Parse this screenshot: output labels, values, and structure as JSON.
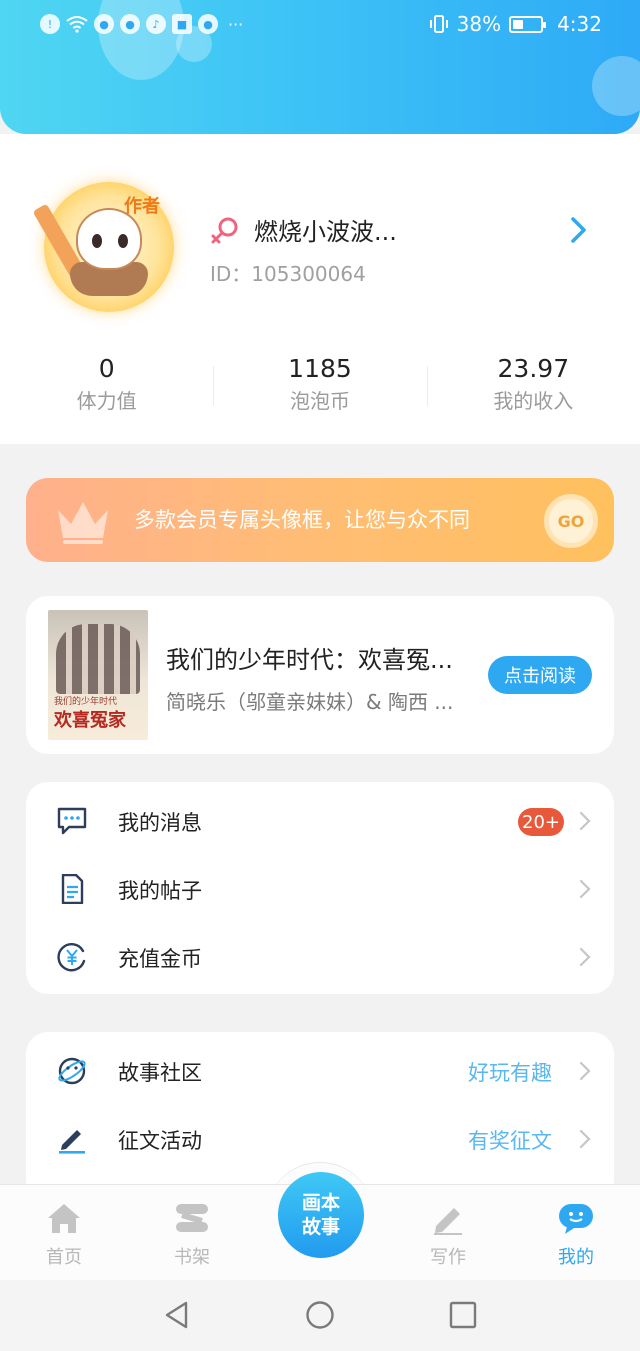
{
  "status_bar": {
    "notification_icons": [
      "info-icon",
      "wifi-icon",
      "app-icon",
      "app-icon",
      "music-icon",
      "game-icon",
      "app-icon"
    ],
    "more": "···",
    "battery_percent": "38%",
    "battery_level": 0.38,
    "time": "4:32"
  },
  "profile": {
    "avatar_tag": "作者",
    "nickname": "燃烧小波波...",
    "user_id": "ID：105300064",
    "stats": [
      {
        "value": "0",
        "label": "体力值"
      },
      {
        "value": "1185",
        "label": "泡泡币"
      },
      {
        "value": "23.97",
        "label": "我的收入"
      }
    ]
  },
  "vip_banner": {
    "text": "多款会员专属头像框，让您与众不同",
    "go_label": "GO"
  },
  "book": {
    "cover_subtitle": "我们的少年时代",
    "cover_title": "欢喜冤家",
    "title": "我们的少年时代：欢喜冤...",
    "authors": "简晓乐（邬童亲妹妹）& 陶西 ...",
    "read_button": "点击阅读"
  },
  "menu": {
    "items": [
      {
        "label": "我的消息",
        "icon": "message-icon",
        "badge": "20+"
      },
      {
        "label": "我的帖子",
        "icon": "document-icon"
      },
      {
        "label": "充值金币",
        "icon": "yen-coin-icon"
      }
    ]
  },
  "menu2": {
    "items": [
      {
        "label": "故事社区",
        "icon": "planet-icon",
        "hint": "好玩有趣"
      },
      {
        "label": "征文活动",
        "icon": "pen-icon",
        "hint": "有奖征文"
      }
    ]
  },
  "tabbar": {
    "tabs": [
      {
        "label": "首页",
        "icon": "home-icon"
      },
      {
        "label": "书架",
        "icon": "bookshelf-icon"
      },
      {
        "label": "写作",
        "icon": "write-icon"
      },
      {
        "label": "我的",
        "icon": "profile-chat-icon",
        "active": true
      }
    ],
    "center_button": [
      "画本",
      "故事"
    ]
  },
  "colors": {
    "accent": "#2ea8f0",
    "badge": "#e8583a",
    "banner_start": "#ffb08c",
    "banner_end": "#ffc05e",
    "hint_text": "#5bb7ef"
  }
}
